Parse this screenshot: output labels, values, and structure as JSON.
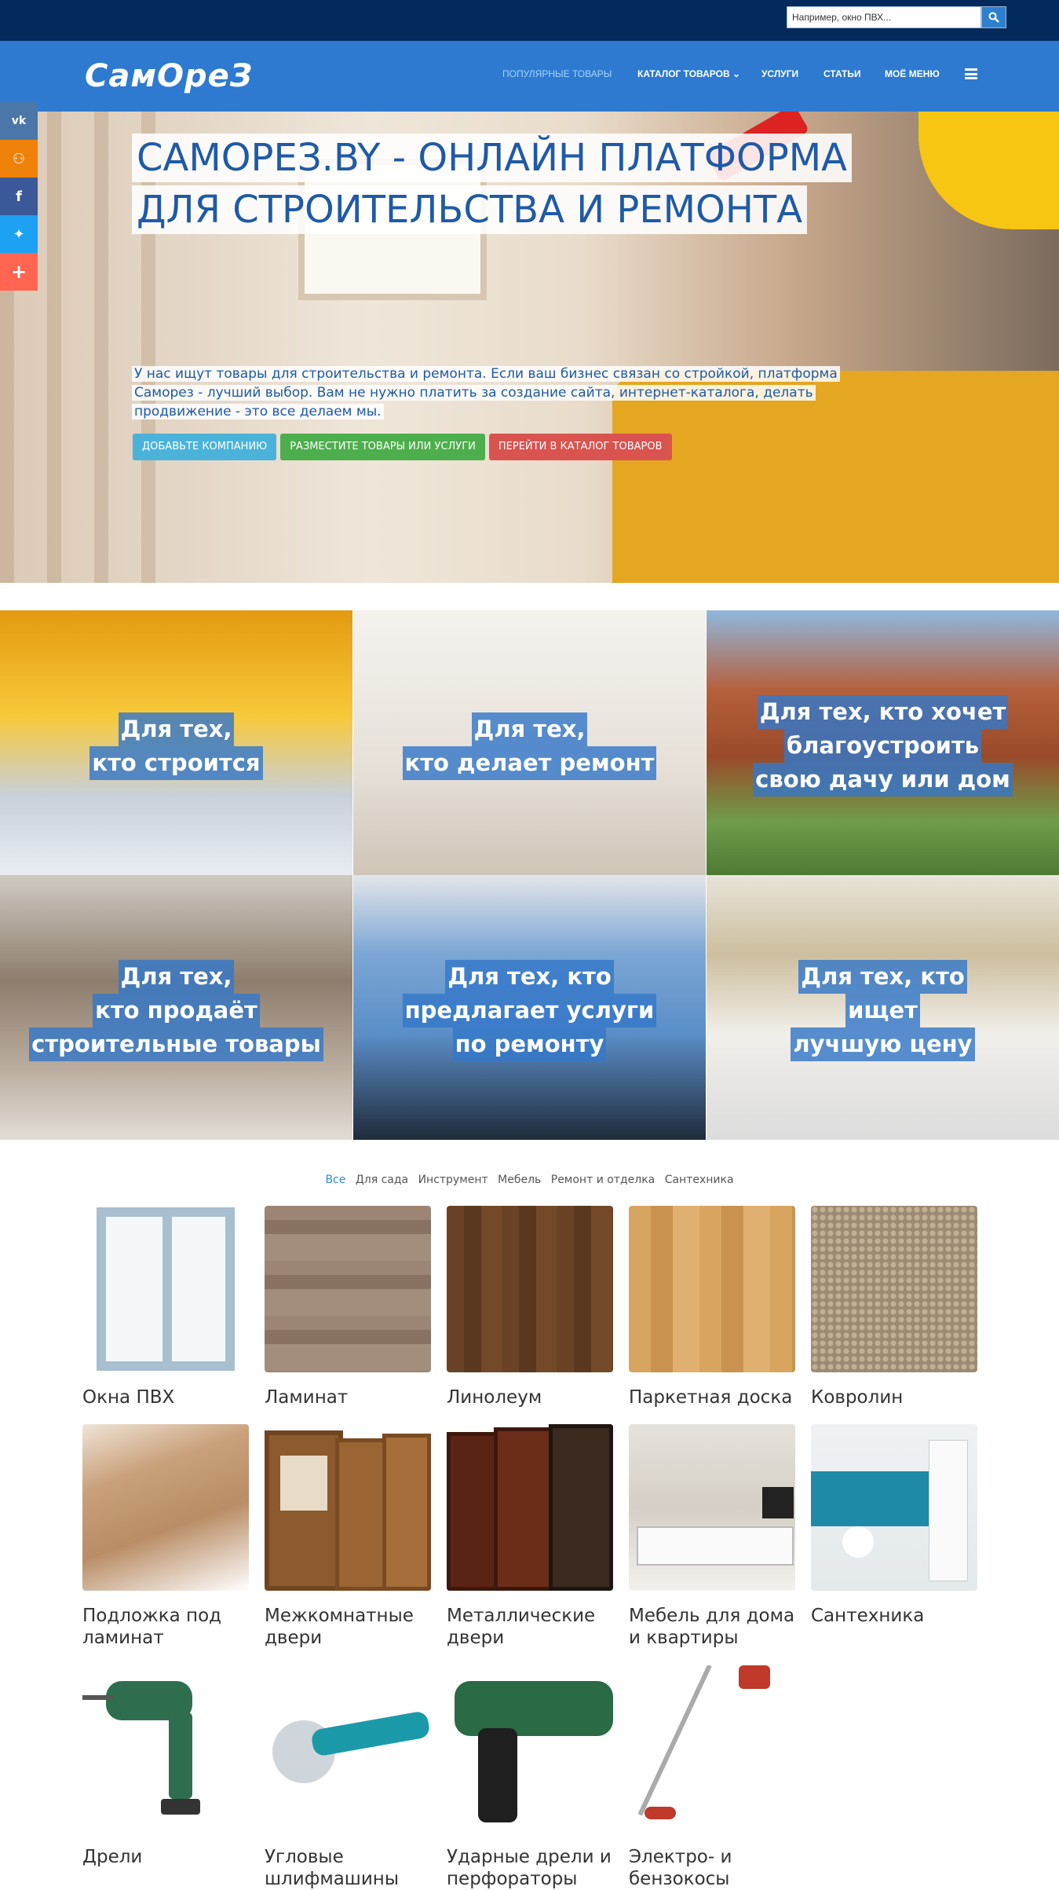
{
  "search": {
    "placeholder": "Например, окно ПВХ..."
  },
  "header": {
    "logo": "СамОреЗ",
    "nav": [
      "ПОПУЛЯРНЫЕ ТОВАРЫ",
      "КАТАЛОГ ТОВАРОВ",
      "УСЛУГИ",
      "СТАТЬИ",
      "МОЁ МЕНЮ"
    ]
  },
  "social": [
    "vk",
    "ok",
    "f",
    "twitter",
    "+"
  ],
  "hero": {
    "title_line1": "САМОРЕЗ.BY - ОНЛАЙН ПЛАТФОРМА",
    "title_line2": "ДЛЯ СТРОИТЕЛЬСТВА И РЕМОНТА",
    "text": "У нас ищут товары для строительства и ремонта. Если ваш бизнес связан со стройкой, платформа Саморез - лучший выбор. Вам не нужно платить за создание сайта, интернет-каталога, делать продвижение - это все делаем мы.",
    "buttons": [
      "ДОБАВЬТЕ КОМПАНИЮ",
      "РАЗМЕСТИТЕ ТОВАРЫ ИЛИ УСЛУГИ",
      "ПЕРЕЙТИ В КАТАЛОГ ТОВАРОВ"
    ]
  },
  "audience_tiles": [
    [
      "Для тех,",
      "кто строится"
    ],
    [
      "Для тех,",
      "кто делает ремонт"
    ],
    [
      "Для тех, кто хочет",
      "благоустроить",
      "свою дачу или дом"
    ],
    [
      "Для тех,",
      "кто продаёт",
      "строительные товары"
    ],
    [
      "Для тех, кто",
      "предлагает услуги",
      "по ремонту"
    ],
    [
      "Для тех, кто",
      "ищет",
      "лучшую цену"
    ]
  ],
  "filters": [
    "Все",
    "Для сада",
    "Инструмент",
    "Мебель",
    "Ремонт и отделка",
    "Сантехника"
  ],
  "products": [
    "Окна ПВХ",
    "Ламинат",
    "Линолеум",
    "Паркетная доска",
    "Ковролин",
    "Подложка под ламинат",
    "Межкомнатные двери",
    "Металлические двери",
    "Мебель для дома и квартиры",
    "Сантехника",
    "Дрели",
    "Угловые шлифмашины",
    "Ударные дрели и перфораторы",
    "Электро- и бензокосы"
  ],
  "colors": {
    "topbar": "#022a5b",
    "navbar": "#2d7ad0",
    "title": "#1f5aa7",
    "btn_add_company": "#4bb3d9",
    "btn_place_goods": "#4cae4c",
    "btn_catalog": "#d9534f",
    "vk": "#4a76a8",
    "ok": "#ee8208",
    "fb": "#3b5998",
    "tw": "#1da1f2",
    "plus": "#ff6550"
  }
}
